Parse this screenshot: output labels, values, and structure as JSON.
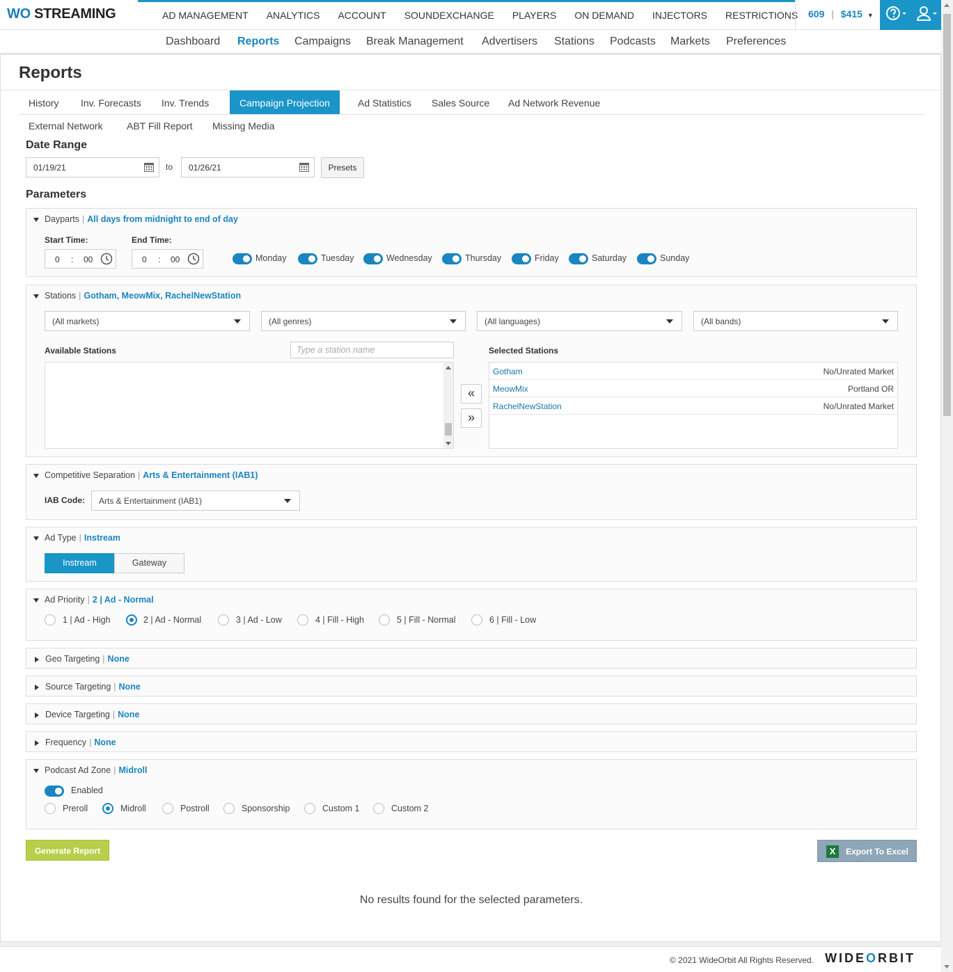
{
  "app": {
    "logo_prefix": "WO",
    "logo_suffix": " STREAMING"
  },
  "topnav": [
    "AD MANAGEMENT",
    "ANALYTICS",
    "ACCOUNT",
    "SOUNDEXCHANGE",
    "PLAYERS",
    "ON DEMAND",
    "INJECTORS",
    "RESTRICTIONS"
  ],
  "credits": {
    "count": "609",
    "sep": "|",
    "amount": "$415"
  },
  "subnav": [
    "Dashboard",
    "Reports",
    "Campaigns",
    "Break Management",
    "Advertisers",
    "Stations",
    "Podcasts",
    "Markets",
    "Preferences"
  ],
  "page_title": "Reports",
  "tabs_row1": [
    "History",
    "Inv. Forecasts",
    "Inv. Trends",
    "Campaign Projection",
    "Ad Statistics",
    "Sales Source",
    "Ad Network Revenue"
  ],
  "tabs_row2": [
    "External Network",
    "ABT Fill Report",
    "Missing Media"
  ],
  "date_range": {
    "label": "Date Range",
    "start": "01/19/21",
    "to": "to",
    "end": "01/26/21",
    "presets": "Presets"
  },
  "parameters_label": "Parameters",
  "dayparts": {
    "title": "Dayparts",
    "value": "All days from midnight to end of day",
    "start_label": "Start Time:",
    "end_label": "End Time:",
    "start_h": "0",
    "start_m": "00",
    "end_h": "0",
    "end_m": "00",
    "days": [
      "Monday",
      "Tuesday",
      "Wednesday",
      "Thursday",
      "Friday",
      "Saturday",
      "Sunday"
    ]
  },
  "stations": {
    "title": "Stations",
    "value": "Gotham, MeowMix, RachelNewStation",
    "filters": [
      "(All markets)",
      "(All genres)",
      "(All languages)",
      "(All bands)"
    ],
    "available_label": "Available Stations",
    "search_placeholder": "Type a station name",
    "selected_label": "Selected Stations",
    "selected": [
      {
        "name": "Gotham",
        "market": "No/Unrated Market"
      },
      {
        "name": "MeowMix",
        "market": "Portland OR"
      },
      {
        "name": "RachelNewStation",
        "market": "No/Unrated Market"
      }
    ]
  },
  "competitive": {
    "title": "Competitive Separation",
    "value": "Arts & Entertainment (IAB1)",
    "iab_label": "IAB Code:",
    "iab_value": "Arts & Entertainment (IAB1)"
  },
  "ad_type": {
    "title": "Ad Type",
    "value": "Instream",
    "options": [
      "Instream",
      "Gateway"
    ]
  },
  "ad_priority": {
    "title": "Ad Priority",
    "value": "2 | Ad - Normal",
    "options": [
      "1 | Ad - High",
      "2 | Ad - Normal",
      "3 | Ad - Low",
      "4 | Fill - High",
      "5 | Fill - Normal",
      "6 | Fill - Low"
    ],
    "selected_index": 1
  },
  "geo": {
    "title": "Geo Targeting",
    "value": "None"
  },
  "source": {
    "title": "Source Targeting",
    "value": "None"
  },
  "device": {
    "title": "Device Targeting",
    "value": "None"
  },
  "frequency": {
    "title": "Frequency",
    "value": "None"
  },
  "podcast": {
    "title": "Podcast Ad Zone",
    "value": "Midroll",
    "enabled_label": "Enabled",
    "options": [
      "Preroll",
      "Midroll",
      "Postroll",
      "Sponsorship",
      "Custom 1",
      "Custom 2"
    ],
    "selected_index": 1
  },
  "buttons": {
    "generate": "Generate Report",
    "export": "Export To Excel",
    "excel_glyph": "X"
  },
  "no_results": "No results found for the selected parameters.",
  "footer": {
    "copyright": "© 2021 WideOrbit All Rights Reserved.",
    "brand_a": "WIDE",
    "brand_o": "O",
    "brand_b": "RBIT"
  },
  "colors": {
    "accent": "#1a95c8",
    "link": "#1a85c0",
    "generate": "#b8cf4a",
    "export": "#8fa6b8"
  }
}
